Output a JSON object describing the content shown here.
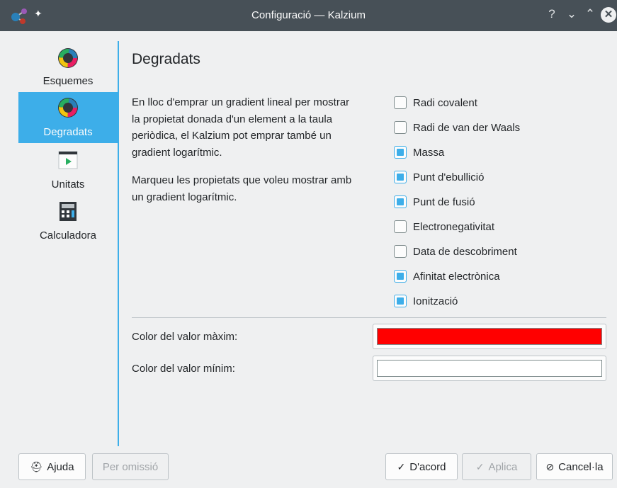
{
  "window": {
    "title": "Configuració — Kalzium",
    "controls": {
      "help": "?",
      "minimize": "⌄",
      "maximize": "⌃",
      "close": "✕"
    }
  },
  "sidebar": {
    "items": [
      {
        "label": "Esquemes",
        "icon": "color-wheel-icon",
        "active": false
      },
      {
        "label": "Degradats",
        "icon": "color-wheel-icon",
        "active": true
      },
      {
        "label": "Unitats",
        "icon": "play-window-icon",
        "active": false
      },
      {
        "label": "Calculadora",
        "icon": "calculator-icon",
        "active": false
      }
    ]
  },
  "page": {
    "title": "Degradats",
    "description1": [
      "En lloc d'emprar un gradient lineal per mostrar",
      "la propietat donada d'un element a la taula",
      "periòdica, el Kalzium pot emprar també un",
      "gradient logarítmic."
    ],
    "description2": [
      "Marqueu les propietats que voleu mostrar amb",
      "un gradient logarítmic."
    ],
    "checkboxes": [
      {
        "label": "Radi covalent",
        "checked": false
      },
      {
        "label": "Radi de van der Waals",
        "checked": false
      },
      {
        "label": "Massa",
        "checked": true
      },
      {
        "label": "Punt d'ebullició",
        "checked": true
      },
      {
        "label": "Punt de fusió",
        "checked": true
      },
      {
        "label": "Electronegativitat",
        "checked": false
      },
      {
        "label": "Data de descobriment",
        "checked": false
      },
      {
        "label": "Afinitat electrònica",
        "checked": true
      },
      {
        "label": "Ionització",
        "checked": true
      }
    ],
    "max_color": {
      "label": "Color del valor màxim:",
      "value": "#ff0000"
    },
    "min_color": {
      "label": "Color del valor mínim:",
      "value": "#ffffff"
    }
  },
  "buttons": {
    "help": "Ajuda",
    "defaults": "Per omissió",
    "ok": "D'acord",
    "apply": "Aplica",
    "cancel": "Cancel·la"
  },
  "colors": {
    "accent": "#3daee9",
    "titlebar": "#475057",
    "background": "#eff0f1"
  }
}
